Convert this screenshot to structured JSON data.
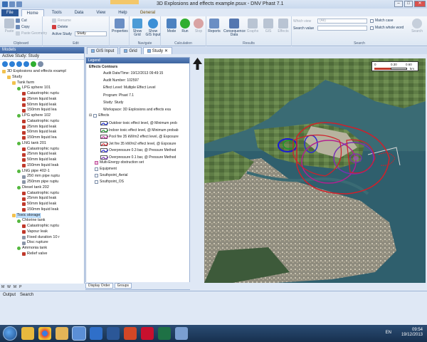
{
  "window": {
    "title": "3D Explosions and effects example.psux - DNV Phast 7.1",
    "buttons": [
      "–",
      "□",
      "✕"
    ]
  },
  "ribbon_tabs": [
    "File",
    "Home",
    "Tools",
    "Data",
    "View",
    "Help",
    "General"
  ],
  "ribbon": {
    "clipboard": {
      "label": "Clipboard",
      "paste": "Paste",
      "cut": "Cut",
      "copy": "Copy",
      "paste_geometry": "Paste Geometry"
    },
    "edit": {
      "label": "Edit",
      "rename": "Rename",
      "delete": "Delete",
      "active_study_label": "Active Study",
      "active_study_value": "Study"
    },
    "properties": {
      "label": "Properties"
    },
    "navigate": {
      "label": "Navigate",
      "show_grid": "Show Grid",
      "show_gis": "Show GIS Input"
    },
    "calculation": {
      "label": "Calculation",
      "mode": "Mode",
      "run": "Run",
      "stop": "Stop"
    },
    "results": {
      "label": "Results",
      "reports": "Reports",
      "consequence": "Consequence Data",
      "graphs": "Graphs",
      "gis": "GIS",
      "effects": "Effects"
    },
    "search": {
      "label": "Search",
      "which_view_label": "Which view",
      "which_view_value": "(All)",
      "search_value_label": "Search value",
      "match_case": "Match case",
      "match_whole_word": "Match whole word",
      "search_button": "Search"
    }
  },
  "models_panel": {
    "title": "Models",
    "active_study": "Active Study: Study",
    "tree": [
      {
        "label": "3D Explosions and effects exampl",
        "level": 0,
        "icon": "folder"
      },
      {
        "label": "Study",
        "level": 1,
        "icon": "folder"
      },
      {
        "label": "Tank farm",
        "level": 2,
        "icon": "folder"
      },
      {
        "label": "LPG sphere 101",
        "level": 3,
        "icon": "sphere"
      },
      {
        "label": "Catastrophic ruptu",
        "level": 4,
        "icon": "red"
      },
      {
        "label": "25mm liquid leak",
        "level": 4,
        "icon": "red"
      },
      {
        "label": "50mm liquid leak",
        "level": 4,
        "icon": "red"
      },
      {
        "label": "150mm liquid lea",
        "level": 4,
        "icon": "red"
      },
      {
        "label": "LPG sphere 102",
        "level": 3,
        "icon": "sphere"
      },
      {
        "label": "Catastrophic ruptu",
        "level": 4,
        "icon": "red"
      },
      {
        "label": "25mm liquid leak",
        "level": 4,
        "icon": "red"
      },
      {
        "label": "50mm liquid leak",
        "level": 4,
        "icon": "red"
      },
      {
        "label": "150mm liquid lea",
        "level": 4,
        "icon": "red"
      },
      {
        "label": "LNG tank 201",
        "level": 3,
        "icon": "sphere"
      },
      {
        "label": "Catastrophic ruptu",
        "level": 4,
        "icon": "red"
      },
      {
        "label": "25mm liquid leak",
        "level": 4,
        "icon": "red"
      },
      {
        "label": "50mm liquid leak",
        "level": 4,
        "icon": "red"
      },
      {
        "label": "150mm liquid leak",
        "level": 4,
        "icon": "red"
      },
      {
        "label": "LNG pipe 402-1",
        "level": 3,
        "icon": "sphere"
      },
      {
        "label": "250 mm pipe ruptu",
        "level": 4,
        "icon": "gray"
      },
      {
        "label": "250mm pipe ruptu",
        "level": 4,
        "icon": "gray"
      },
      {
        "label": "Diesel tank 202",
        "level": 3,
        "icon": "sphere"
      },
      {
        "label": "Catastrophic ruptu",
        "level": 4,
        "icon": "red"
      },
      {
        "label": "25mm liquid leak",
        "level": 4,
        "icon": "red"
      },
      {
        "label": "50mm liquid leak",
        "level": 4,
        "icon": "red"
      },
      {
        "label": "150mm liquid leak",
        "level": 4,
        "icon": "red"
      },
      {
        "label": "Toxic storage",
        "level": 2,
        "icon": "folder",
        "selected": true
      },
      {
        "label": "Chlorine tank",
        "level": 3,
        "icon": "sphere"
      },
      {
        "label": "Catastrophic ruptu",
        "level": 4,
        "icon": "red"
      },
      {
        "label": "Vapour leak",
        "level": 4,
        "icon": "red"
      },
      {
        "label": "Fixed duration 10 r",
        "level": 4,
        "icon": "gray"
      },
      {
        "label": "Disc rupture",
        "level": 4,
        "icon": "gray"
      },
      {
        "label": "Ammonia tank",
        "level": 3,
        "icon": "sphere"
      },
      {
        "label": "Relief valve",
        "level": 4,
        "icon": "red"
      }
    ],
    "bottom_tabs": [
      "M",
      "W",
      "M",
      "P"
    ]
  },
  "doc_tabs": [
    "GIS Input",
    "Grid",
    "Study"
  ],
  "legend": {
    "title": "Legend",
    "header": "Effects Contours",
    "meta": [
      "Audit Date/Time: 19/12/2013 09:49:15",
      "Audit Number: 102597",
      "Effect Level: Multiple Effect Level",
      "Program: Phast 7.1",
      "Study: Study",
      "Workspace: 3D Explosions and effects exa"
    ],
    "effects_label": "Effects",
    "effects": [
      {
        "label": "Outdoor toxic effect level, @ Minimum prob",
        "color": "#1f2fd0"
      },
      {
        "label": "Indoor toxic effect level, @ Minimum probab",
        "color": "#1a9a2a"
      },
      {
        "label": "Pool fire 35 kW/m2 effect level, @ Exposure",
        "color": "#b31f8f"
      },
      {
        "label": "Jet fire 35 kW/m2 effect level, @ Exposure",
        "color": "#d0202a"
      },
      {
        "label": "Overpressure 0.3 bar, @ Pressure Method",
        "color": "#2b2bd6"
      },
      {
        "label": "Overpressure 0.1 bar, @ Pressure Method",
        "color": "#7a2fb5"
      }
    ],
    "extras": [
      "Multi-Energy obstruction set",
      "Equipment",
      "Southpoint_Aerial",
      "Southpoint_OS"
    ],
    "bottom_tabs": [
      "Display Order",
      "Groups"
    ]
  },
  "map": {
    "scale_labels": [
      "0",
      "0.30",
      "0.60"
    ],
    "scale_unit": "km"
  },
  "status_tabs": [
    "Output",
    "Search"
  ],
  "taskbar": {
    "time": "09:54",
    "date": "19/12/2013",
    "lang": "EN"
  }
}
